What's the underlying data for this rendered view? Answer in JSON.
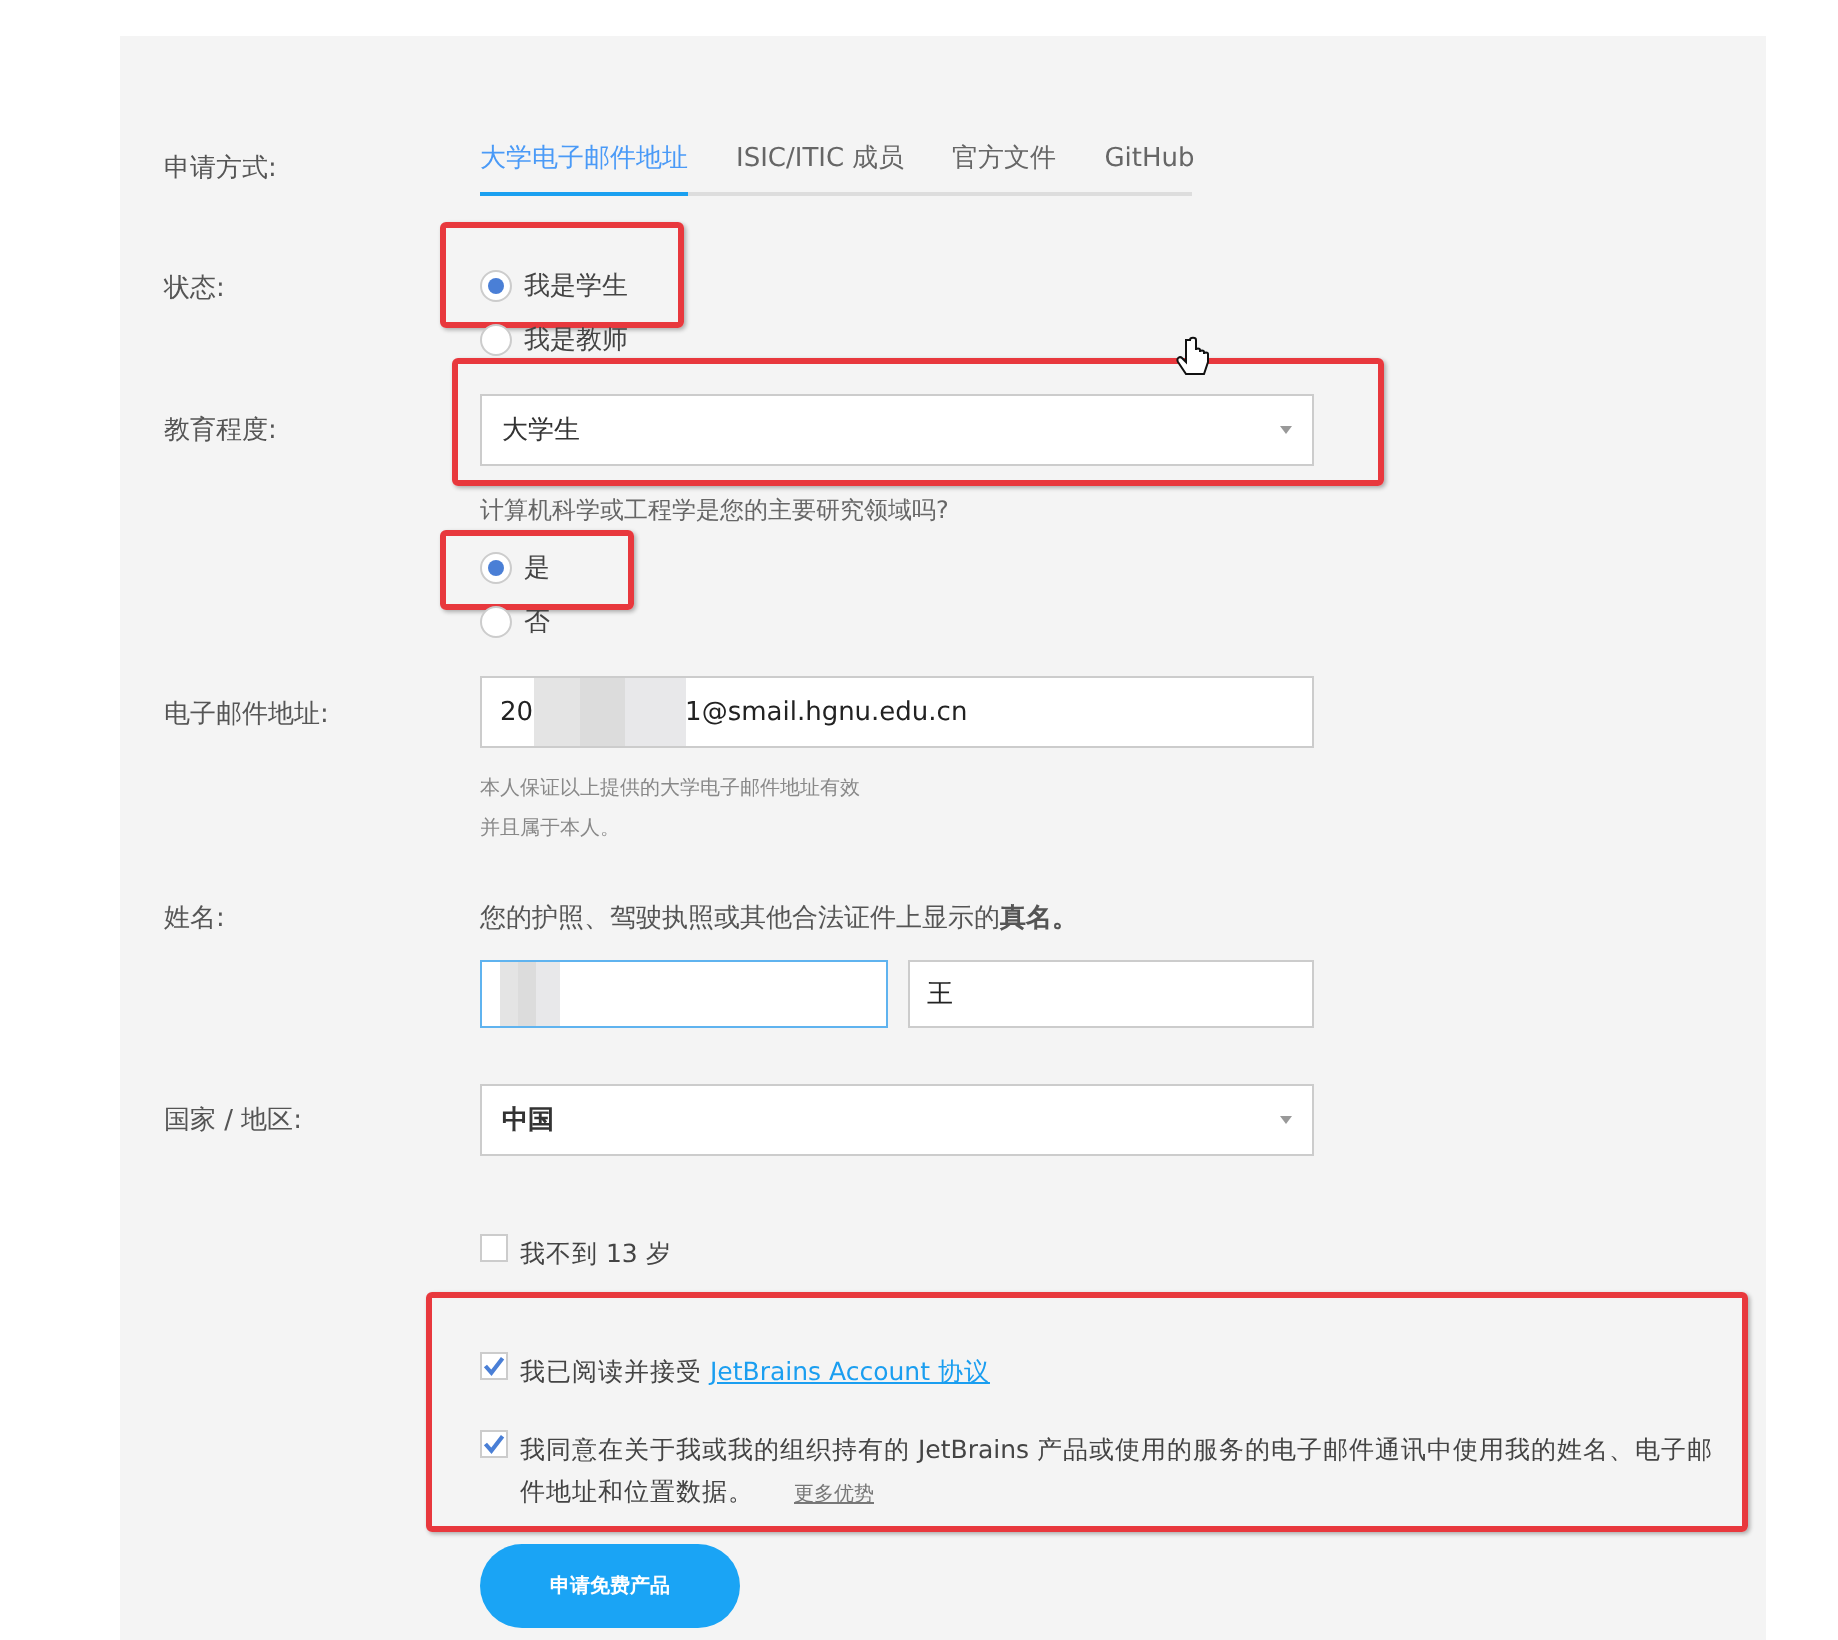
{
  "application_method": {
    "label": "申请方式:",
    "tabs": [
      {
        "label": "大学电子邮件地址",
        "selected": true
      },
      {
        "label": "ISIC/ITIC 成员",
        "selected": false
      },
      {
        "label": "官方文件",
        "selected": false
      },
      {
        "label": "GitHub",
        "selected": false
      }
    ]
  },
  "status": {
    "label": "状态:",
    "options": [
      {
        "label": "我是学生",
        "selected": true,
        "highlighted": true
      },
      {
        "label": "我是教师",
        "selected": false,
        "highlighted": false
      }
    ]
  },
  "education": {
    "label": "教育程度:",
    "value": "大学生",
    "highlighted": true,
    "question": "计算机科学或工程学是您的主要研究领域吗?",
    "options": [
      {
        "label": "是",
        "selected": true,
        "highlighted": true
      },
      {
        "label": "否",
        "selected": false,
        "highlighted": false
      }
    ]
  },
  "email": {
    "label": "电子邮件地址:",
    "value_start": "20",
    "value_end": "1@smail.hgnu.edu.cn",
    "redacted": true,
    "hint_lines": [
      "本人保证以上提供的大学电子邮件地址有效",
      "并且属于本人。"
    ]
  },
  "name": {
    "label": "姓名:",
    "hint": "您的护照、驾驶执照或其他合法证件上显示的**真名。**",
    "first": {
      "redacted": true,
      "focused": true
    },
    "last": {
      "value": "王",
      "focused": false
    }
  },
  "country": {
    "label": "国家 / 地区:",
    "value": "中国"
  },
  "under_13": {
    "label": "我不到 13 岁",
    "checked": false
  },
  "agreements": {
    "highlighted": true,
    "items": [
      {
        "text": "我已阅读并接受",
        "link": "JetBrains Account 协议",
        "checked": true
      },
      {
        "text": "我同意在关于我或我的组织持有的 JetBrains 产品或使用的服务的电子邮件通讯中使用我的姓名、电子邮件地址和位置数据。",
        "link": "更多优势",
        "checked": true
      }
    ]
  },
  "submit": {
    "label": "申请免费产品"
  }
}
